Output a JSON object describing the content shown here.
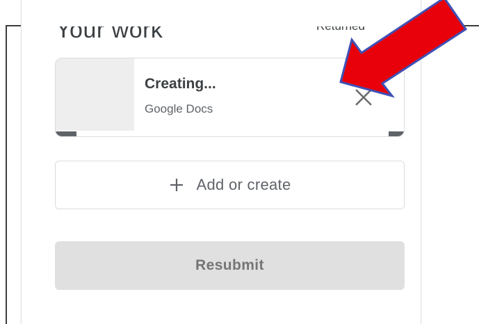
{
  "panel": {
    "heading": "Your work",
    "status": "Returned"
  },
  "attachment": {
    "title": "Creating...",
    "subtitle": "Google Docs",
    "remove_icon": "close-icon"
  },
  "add_button": {
    "label": "Add or create",
    "icon": "plus-icon"
  },
  "resubmit_button": {
    "label": "Resubmit"
  },
  "annotation": {
    "arrow_color": "#e8000b",
    "arrow_outline": "#3f51b5"
  },
  "colors": {
    "text_primary": "#3c4043",
    "text_secondary": "#5f6368",
    "border": "#dadce0",
    "disabled_bg": "#e0e0e0"
  }
}
